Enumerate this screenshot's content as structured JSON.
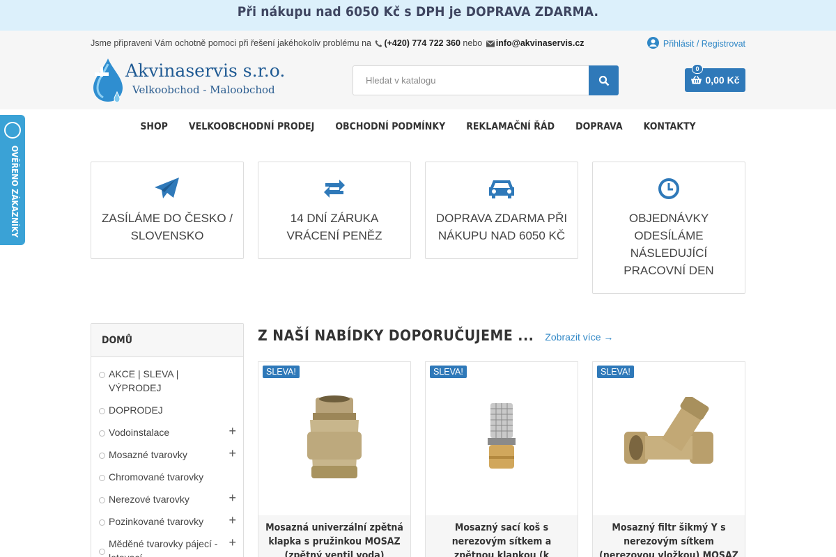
{
  "promo": {
    "text": "Při nákupu nad 6050 Kč s DPH je DOPRAVA ZDARMA."
  },
  "topbar": {
    "help_text": "Jsme připraveni Vám ochotně pomoci při řešení jakéhokoliv problému na",
    "phone": "(+420) 774 722 360",
    "or": "nebo",
    "email": "info@akvinaservis.cz",
    "login": "Přihlásit / Registrovat"
  },
  "logo": {
    "title": "Akvinaservis s.r.o.",
    "subtitle": "Velkoobchod - Maloobchod"
  },
  "search": {
    "placeholder": "Hledat v katalogu"
  },
  "cart": {
    "count": "0",
    "total": "0,00 Kč"
  },
  "nav": [
    "SHOP",
    "VELKOOBCHODNÍ PRODEJ",
    "OBCHODNÍ PODMÍNKY",
    "REKLAMAČNÍ ŘÁD",
    "DOPRAVA",
    "KONTAKTY"
  ],
  "side_badge": {
    "text": "OVĚŘENO ZÁKAZNÍKY"
  },
  "features": [
    {
      "icon": "paper-plane-icon",
      "text": "ZASÍLÁME DO ČESKO / SLOVENSKO"
    },
    {
      "icon": "exchange-icon",
      "text": "14 DNÍ ZÁRUKA VRÁCENÍ PENĚZ"
    },
    {
      "icon": "car-icon",
      "text": "DOPRAVA ZDARMA PŘI NÁKUPU NAD 6050 Kč"
    },
    {
      "icon": "clock-icon",
      "text": "OBJEDNÁVKY ODESÍLÁME NÁSLEDUJÍCÍ PRACOVNÍ DEN"
    }
  ],
  "sidebar": {
    "heading": "DOMŮ",
    "items": [
      {
        "label": "AKCE | SLEVA | VÝPRODEJ",
        "expandable": false
      },
      {
        "label": "DOPRODEJ",
        "expandable": false
      },
      {
        "label": "Vodoinstalace",
        "expandable": true
      },
      {
        "label": "Mosazné tvarovky",
        "expandable": true
      },
      {
        "label": "Chromované tvarovky",
        "expandable": false
      },
      {
        "label": "Nerezové tvarovky",
        "expandable": true
      },
      {
        "label": "Pozinkované tvarovky",
        "expandable": true
      },
      {
        "label": "Měděné tvarovky pájecí - letovací",
        "expandable": true
      }
    ]
  },
  "section": {
    "title": "Z NAŠÍ NABÍDKY DOPORUČUJEME ...",
    "more": "Zobrazit více"
  },
  "products": [
    {
      "badge": "SLEVA!",
      "name": "Mosazná univerzální zpětná klapka s pružinkou MOSAZ (zpětný ventil voda)"
    },
    {
      "badge": "SLEVA!",
      "name": "Mosazný sací koš s nerezovým sítkem a zpětnou klapkou (k čerpadlu)"
    },
    {
      "badge": "SLEVA!",
      "name": "Mosazný filtr šikmý Y s nerezovým sítkem (nerezovou vložkou) MOSAZ"
    }
  ],
  "colors": {
    "accent": "#2f79b9",
    "promo_bg": "#dcf0fb",
    "link": "#2f87c6",
    "badge": "#3aa2d6"
  }
}
